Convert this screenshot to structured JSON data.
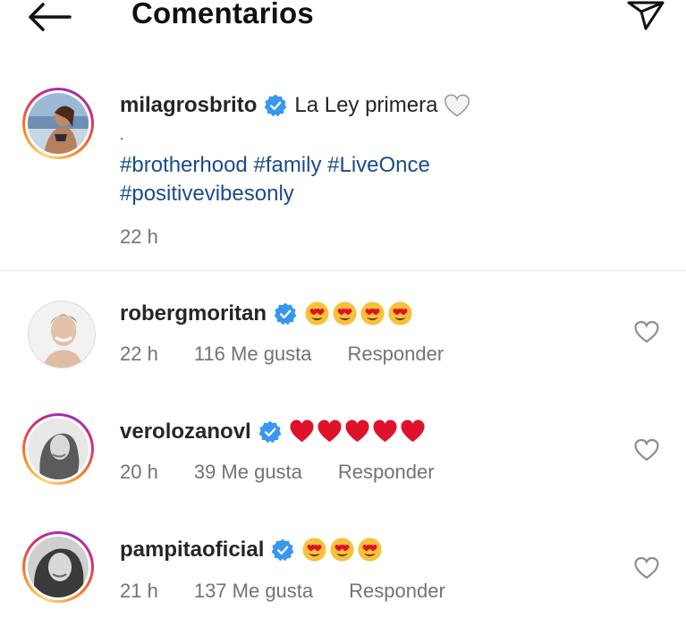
{
  "header": {
    "title": "Comentarios",
    "back_icon": "arrow-left-icon",
    "share_icon": "paper-plane-icon"
  },
  "caption": {
    "username": "milagrosbrito",
    "text": "La Ley primera",
    "dot": ".",
    "hashtags_line1": "#brotherhood #family #LiveOnce",
    "hashtags_line2": "#positivevibesonly",
    "time": "22 h"
  },
  "comments": [
    {
      "username": "robergmoritan",
      "emoji": "heart-eyes-emoji",
      "emoji_count": 4,
      "time": "22 h",
      "likes": "116 Me gusta",
      "reply": "Responder"
    },
    {
      "username": "verolozanovl",
      "emoji": "red-heart-emoji",
      "emoji_count": 5,
      "time": "20 h",
      "likes": "39 Me gusta",
      "reply": "Responder"
    },
    {
      "username": "pampitaoficial",
      "emoji": "heart-eyes-emoji",
      "emoji_count": 3,
      "time": "21 h",
      "likes": "137 Me gusta",
      "reply": "Responder"
    }
  ],
  "colors": {
    "verified": "#3897f0",
    "hashtag": "#1a4c8b",
    "meta": "#737373",
    "heart_red": "#e0112b",
    "emoji_yellow": "#f7c23a"
  }
}
